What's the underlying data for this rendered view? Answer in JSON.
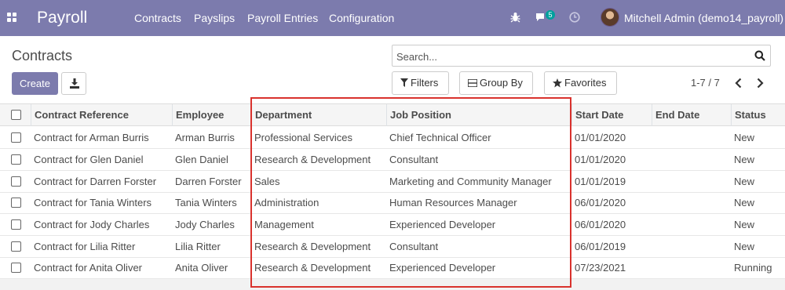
{
  "navbar": {
    "app_title": "Payroll",
    "menu": [
      "Contracts",
      "Payslips",
      "Payroll Entries",
      "Configuration"
    ],
    "messages_badge": "5",
    "user_name": "Mitchell Admin (demo14_payroll)",
    "icons": [
      "apps-icon",
      "bug-icon",
      "chat-icon",
      "clock-icon"
    ]
  },
  "control_panel": {
    "breadcrumb": "Contracts",
    "create_label": "Create",
    "search_placeholder": "Search...",
    "filters_label": "Filters",
    "group_by_label": "Group By",
    "favorites_label": "Favorites",
    "pager": "1-7 / 7"
  },
  "table": {
    "columns": [
      "Contract Reference",
      "Employee",
      "Department",
      "Job Position",
      "Start Date",
      "End Date",
      "Status"
    ],
    "rows": [
      [
        "Contract for Arman Burris",
        "Arman Burris",
        "Professional Services",
        "Chief Technical Officer",
        "01/01/2020",
        "",
        "New"
      ],
      [
        "Contract for Glen Daniel",
        "Glen Daniel",
        "Research & Development",
        "Consultant",
        "01/01/2020",
        "",
        "New"
      ],
      [
        "Contract for Darren Forster",
        "Darren Forster",
        "Sales",
        "Marketing and Community Manager",
        "01/01/2019",
        "",
        "New"
      ],
      [
        "Contract for Tania Winters",
        "Tania Winters",
        "Administration",
        "Human Resources Manager",
        "06/01/2020",
        "",
        "New"
      ],
      [
        "Contract for Jody Charles",
        "Jody Charles",
        "Management",
        "Experienced Developer",
        "06/01/2020",
        "",
        "New"
      ],
      [
        "Contract for Lilia Ritter",
        "Lilia Ritter",
        "Research & Development",
        "Consultant",
        "06/01/2019",
        "",
        "New"
      ],
      [
        "Contract for Anita Oliver",
        "Anita Oliver",
        "Research & Development",
        "Experienced Developer",
        "07/23/2021",
        "",
        "Running"
      ]
    ]
  },
  "colors": {
    "navbar": "#7c7bad",
    "badge": "#00a09d",
    "highlight": "#d9322d"
  }
}
